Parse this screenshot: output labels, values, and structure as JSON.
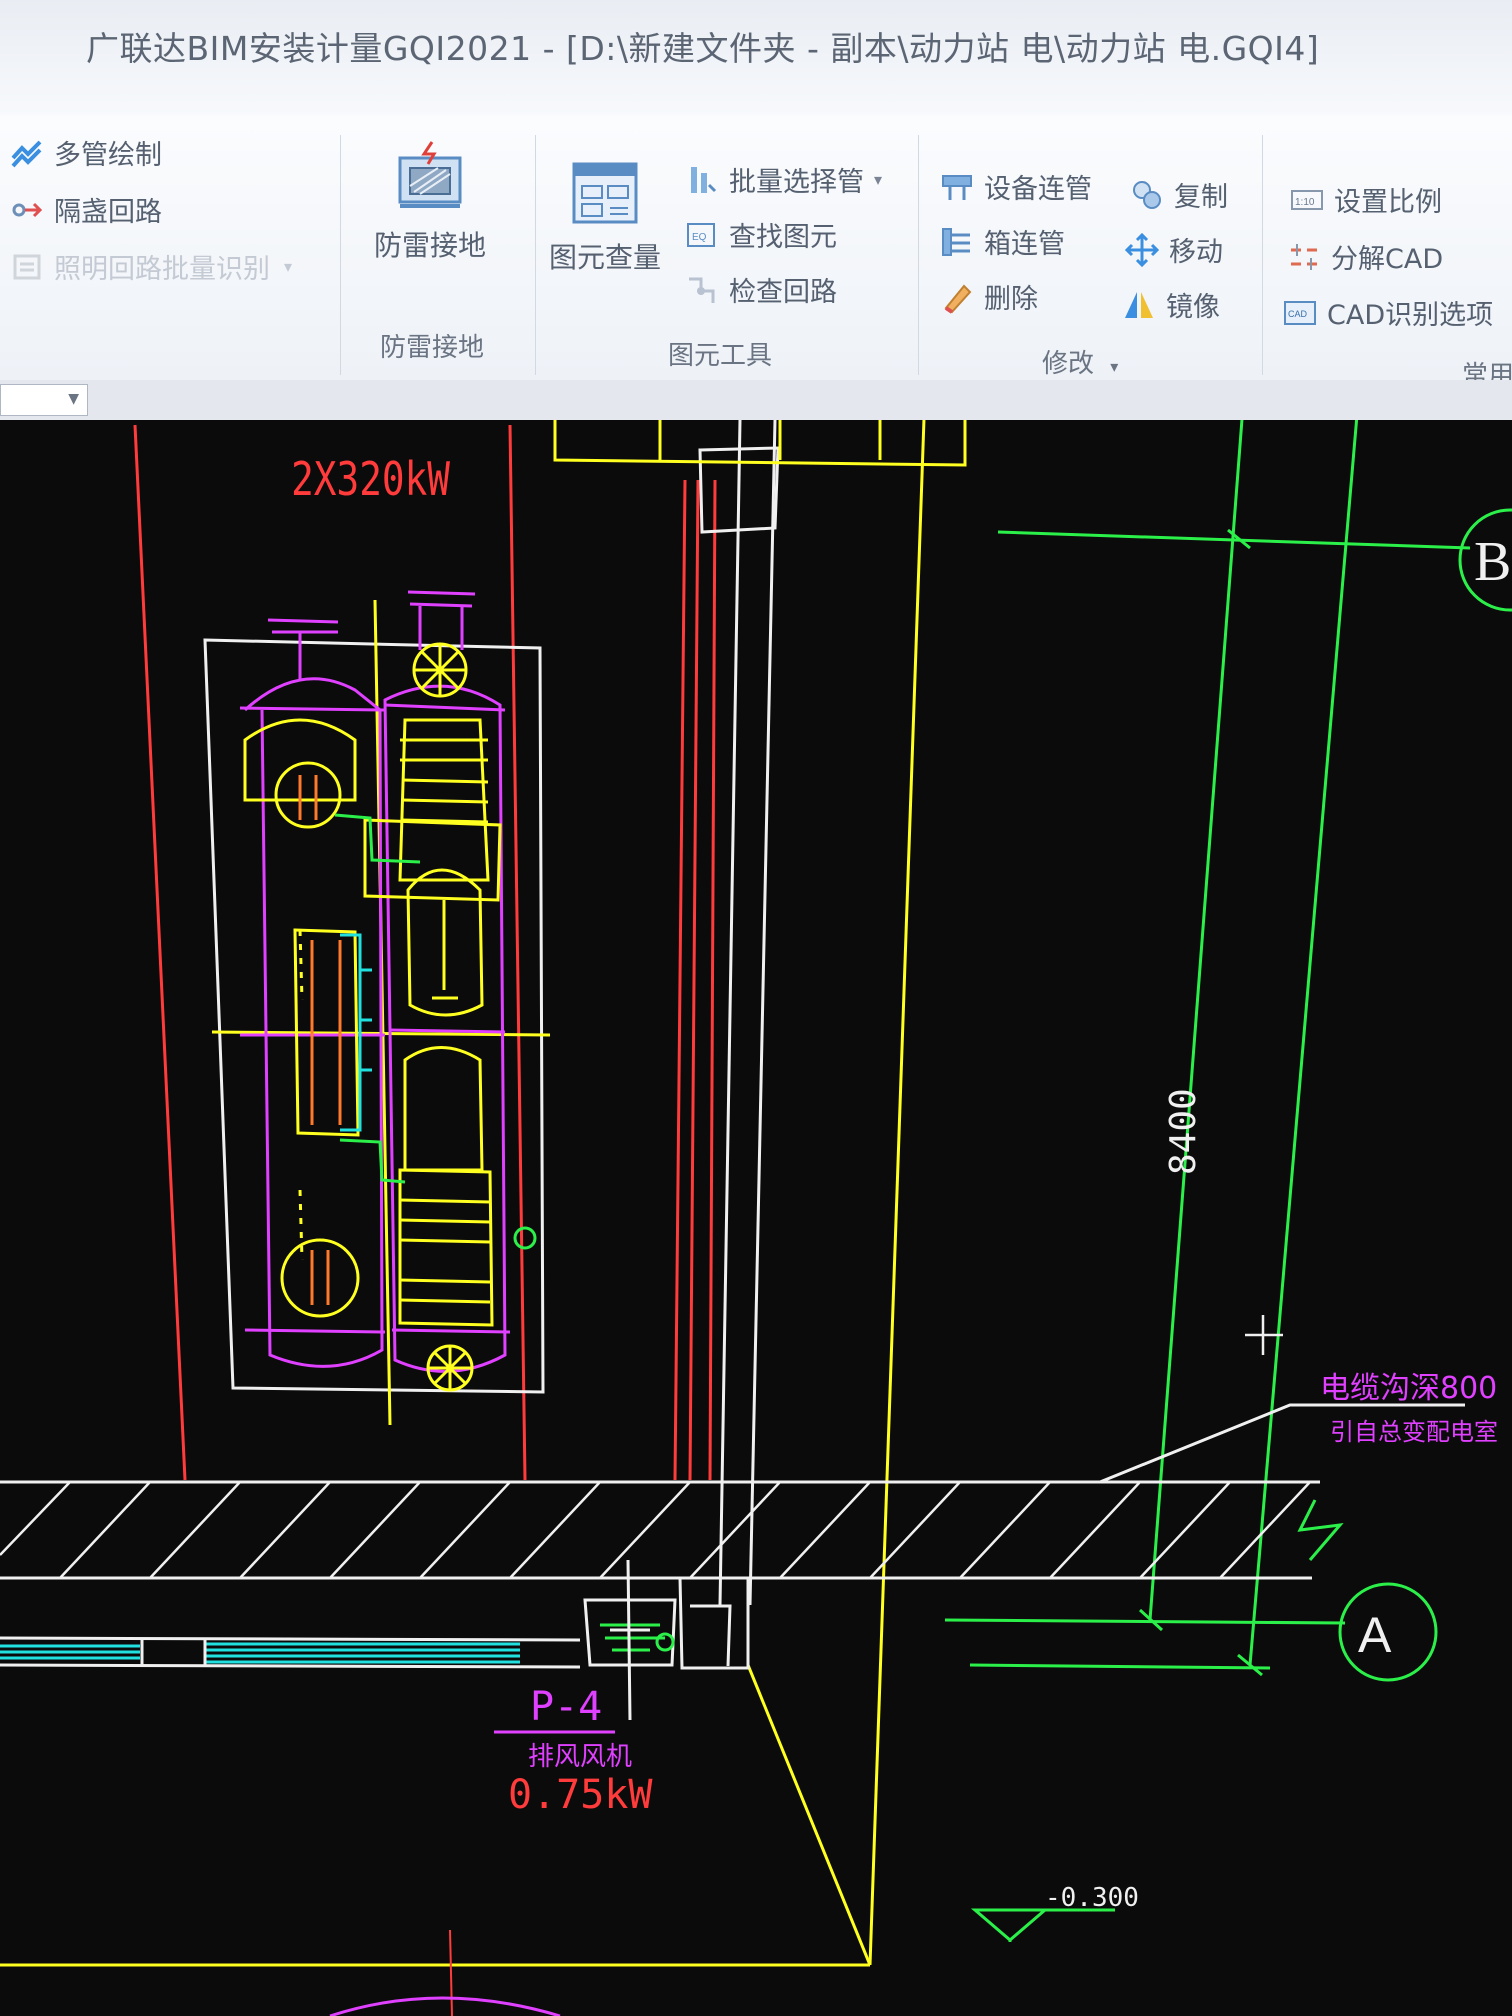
{
  "window": {
    "title": "广联达BIM安装计量GQI2021 - [D:\\新建文件夹 - 副本\\动力站  电\\动力站 电.GQI4]"
  },
  "ribbon": {
    "left_items": [
      {
        "label": "多管绘制"
      },
      {
        "label": "隔盏回路"
      },
      {
        "label": "照明回路批量识别"
      }
    ],
    "lightning_group": {
      "button_label": "防雷接地",
      "group_label": "防雷接地"
    },
    "element_tools": {
      "big_button_label": "图元查量",
      "items": [
        {
          "label": "批量选择管"
        },
        {
          "label": "查找图元"
        },
        {
          "label": "检查回路"
        }
      ],
      "group_label": "图元工具"
    },
    "modify": {
      "col1": [
        {
          "label": "设备连管"
        },
        {
          "label": "箱连管"
        },
        {
          "label": "删除"
        }
      ],
      "col2": [
        {
          "label": "复制"
        },
        {
          "label": "移动"
        },
        {
          "label": "镜像"
        }
      ],
      "group_label": "修改"
    },
    "common": {
      "items": [
        {
          "label": "设置比例"
        },
        {
          "label": "分解CAD"
        },
        {
          "label": "CAD识别选项"
        }
      ],
      "group_label": "常用"
    },
    "scale_icon_text": "1:10",
    "cad_icon_text": "CAD"
  },
  "drawing": {
    "power_label": "2X320kW",
    "dimension": "8400",
    "grid_b": "B",
    "grid_a": "A",
    "pump_tag": "P-4",
    "pump_name": "排风风机",
    "pump_power": "0.75kW",
    "elevation": "-0.300",
    "cable_note_line1": "电缆沟深800",
    "cable_note_line2": "引自总变配电室"
  },
  "colors": {
    "cad_background": "#0b0b0b",
    "cad_red": "#ff3b3b",
    "cad_yellow": "#ffff20",
    "cad_magenta": "#e040ff",
    "cad_green": "#2cf04a",
    "cad_cyan": "#20e0e0",
    "cad_white": "#f0f0f0",
    "ribbon_text": "#556070"
  }
}
